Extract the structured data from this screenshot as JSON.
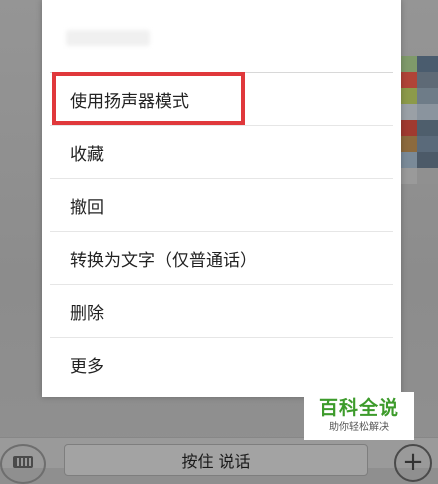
{
  "menu": {
    "items": [
      {
        "label": "使用扬声器模式"
      },
      {
        "label": "收藏"
      },
      {
        "label": "撤回"
      },
      {
        "label": "转换为文字（仅普通话）"
      },
      {
        "label": "删除"
      },
      {
        "label": "更多"
      }
    ],
    "highlighted_item_index": 0,
    "highlight_color": "#e0383b"
  },
  "input_bar": {
    "talk_button_label": "按住 说话",
    "plus_label": "+",
    "keyboard_icon": "keyboard-icon",
    "plus_icon": "plus-icon"
  },
  "watermark": {
    "title": "百科全说",
    "subtitle": "助你轻松解决",
    "color": "#3d9b2b"
  }
}
